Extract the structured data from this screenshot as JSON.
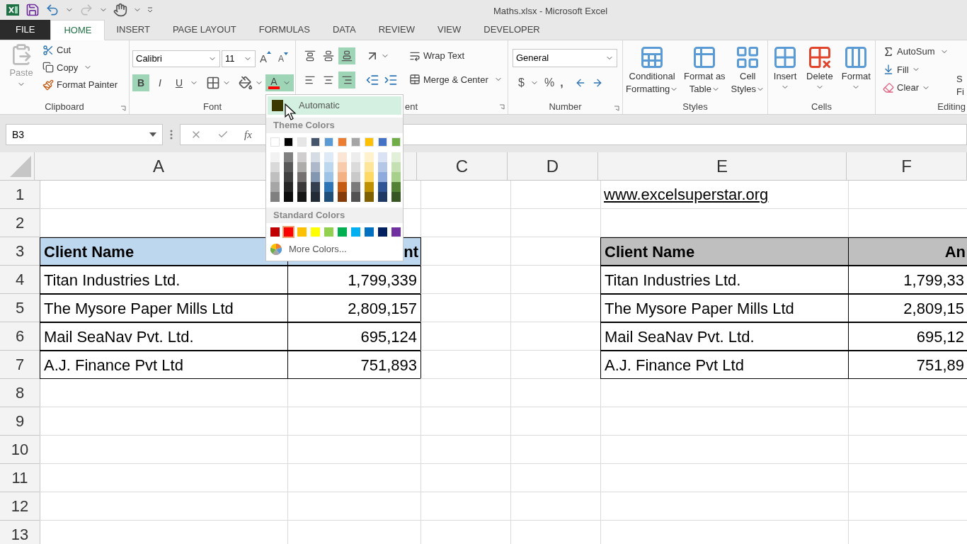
{
  "window": {
    "title": "Maths.xlsx - Microsoft Excel"
  },
  "tabs": [
    {
      "label": "FILE",
      "kind": "file",
      "selected": false
    },
    {
      "label": "HOME",
      "kind": "tab",
      "selected": true
    },
    {
      "label": "INSERT",
      "kind": "tab",
      "selected": false
    },
    {
      "label": "PAGE LAYOUT",
      "kind": "tab",
      "selected": false
    },
    {
      "label": "FORMULAS",
      "kind": "tab",
      "selected": false
    },
    {
      "label": "DATA",
      "kind": "tab",
      "selected": false
    },
    {
      "label": "REVIEW",
      "kind": "tab",
      "selected": false
    },
    {
      "label": "VIEW",
      "kind": "tab",
      "selected": false
    },
    {
      "label": "DEVELOPER",
      "kind": "tab",
      "selected": false
    }
  ],
  "ribbon": {
    "clipboard": {
      "label": "Clipboard",
      "paste": "Paste",
      "cut": "Cut",
      "copy": "Copy",
      "format_painter": "Format Painter"
    },
    "font": {
      "label": "Font",
      "font_name": "Calibri",
      "font_size": "11",
      "grow": "A",
      "shrink": "A",
      "bold": {
        "label": "B",
        "selected": true
      },
      "italic": {
        "label": "I",
        "selected": false
      },
      "underline": {
        "label": "U",
        "selected": false
      },
      "font_color": {
        "label": "A",
        "color": "#ff0000",
        "expanded": true
      }
    },
    "alignment": {
      "label": "ent",
      "vertical": [
        {
          "selected": false
        },
        {
          "selected": false
        },
        {
          "selected": true
        }
      ],
      "horizontal": [
        {
          "selected": false
        },
        {
          "selected": false
        },
        {
          "selected": true
        }
      ],
      "wrap_text": "Wrap Text",
      "merge": "Merge & Center"
    },
    "number": {
      "label": "Number",
      "format": "General",
      "currency": "$",
      "percent": "%",
      "comma": ","
    },
    "styles": {
      "label": "Styles",
      "buttons": [
        {
          "lines": [
            "Conditional",
            "Formatting"
          ]
        },
        {
          "lines": [
            "Format as",
            "Table"
          ]
        },
        {
          "lines": [
            "Cell",
            "Styles"
          ]
        }
      ]
    },
    "cells": {
      "label": "Cells",
      "buttons": [
        "Insert",
        "Delete",
        "Format"
      ]
    },
    "editing": {
      "label": "Editing",
      "autosum": "AutoSum",
      "fill": "Fill",
      "clear": "Clear",
      "cut_top": "S",
      "cut_bottom": "Fi"
    }
  },
  "color_picker": {
    "automatic": {
      "label": "Automatic",
      "color": "#3b3800"
    },
    "theme_label": "Theme Colors",
    "theme": [
      {
        "color": "#ffffff",
        "shades": [
          {
            "color": "#f2f2f2"
          },
          {
            "color": "#d9d9d9"
          },
          {
            "color": "#bfbfbf"
          },
          {
            "color": "#a6a6a6"
          },
          {
            "color": "#808080"
          }
        ]
      },
      {
        "color": "#000000",
        "shades": [
          {
            "color": "#808080"
          },
          {
            "color": "#595959"
          },
          {
            "color": "#404040"
          },
          {
            "color": "#262626"
          },
          {
            "color": "#0d0d0d"
          }
        ]
      },
      {
        "color": "#e7e6e6",
        "shades": [
          {
            "color": "#d0cece"
          },
          {
            "color": "#aeabab"
          },
          {
            "color": "#757171"
          },
          {
            "color": "#3a3838"
          },
          {
            "color": "#171616"
          }
        ]
      },
      {
        "color": "#44546a",
        "shades": [
          {
            "color": "#d6dce4"
          },
          {
            "color": "#adb9ca"
          },
          {
            "color": "#8497b0"
          },
          {
            "color": "#333f4f"
          },
          {
            "color": "#222a35"
          }
        ]
      },
      {
        "color": "#5b9bd5",
        "shades": [
          {
            "color": "#deebf6"
          },
          {
            "color": "#bdd7ee"
          },
          {
            "color": "#9dc3e6"
          },
          {
            "color": "#2e75b5"
          },
          {
            "color": "#1f4e79"
          }
        ]
      },
      {
        "color": "#ed7d31",
        "shades": [
          {
            "color": "#fbe5d5"
          },
          {
            "color": "#f7cbac"
          },
          {
            "color": "#f4b183"
          },
          {
            "color": "#c55a11"
          },
          {
            "color": "#843c0b"
          }
        ]
      },
      {
        "color": "#a5a5a5",
        "shades": [
          {
            "color": "#ededed"
          },
          {
            "color": "#dbdbdb"
          },
          {
            "color": "#c9c9c9"
          },
          {
            "color": "#7b7b7b"
          },
          {
            "color": "#525252"
          }
        ]
      },
      {
        "color": "#ffc000",
        "shades": [
          {
            "color": "#fff2cc"
          },
          {
            "color": "#fee599"
          },
          {
            "color": "#ffd965"
          },
          {
            "color": "#bf9000"
          },
          {
            "color": "#7f6000"
          }
        ]
      },
      {
        "color": "#4472c4",
        "shades": [
          {
            "color": "#dae3f3"
          },
          {
            "color": "#b4c7e7"
          },
          {
            "color": "#8faadc"
          },
          {
            "color": "#2f5597"
          },
          {
            "color": "#203864"
          }
        ]
      },
      {
        "color": "#70ad47",
        "shades": [
          {
            "color": "#e2efd9"
          },
          {
            "color": "#c5e0b3"
          },
          {
            "color": "#a8d08d"
          },
          {
            "color": "#538135"
          },
          {
            "color": "#375623"
          }
        ]
      }
    ],
    "standard_label": "Standard Colors",
    "standard": [
      {
        "color": "#c00000",
        "selected": false
      },
      {
        "color": "#ff0000",
        "selected": true
      },
      {
        "color": "#ffc000",
        "selected": false
      },
      {
        "color": "#ffff00",
        "selected": false
      },
      {
        "color": "#92d050",
        "selected": false
      },
      {
        "color": "#00b050",
        "selected": false
      },
      {
        "color": "#00b0f0",
        "selected": false
      },
      {
        "color": "#0070c0",
        "selected": false
      },
      {
        "color": "#002060",
        "selected": false
      },
      {
        "color": "#7030a0",
        "selected": false
      }
    ],
    "more": "More Colors..."
  },
  "formula_bar": {
    "name_box": "B3",
    "function_label": "fx"
  },
  "sheet": {
    "columns": [
      {
        "kind": "shown",
        "label": "A"
      },
      {
        "kind": "covered"
      },
      {
        "kind": "shown",
        "label": "C"
      },
      {
        "kind": "shown",
        "label": "D"
      },
      {
        "kind": "shown",
        "label": "E"
      },
      {
        "kind": "shown",
        "label": "F"
      }
    ],
    "rows": [
      {
        "number": "1",
        "cells": [
          {
            "kind": "blank"
          },
          {
            "kind": "blank"
          },
          {
            "kind": "blank"
          },
          {
            "kind": "blank"
          },
          {
            "kind": "link",
            "text": "www.excelsuperstar.org"
          },
          {
            "kind": "blank"
          }
        ]
      },
      {
        "number": "2"
      },
      {
        "number": "3",
        "cells": [
          {
            "kind": "header",
            "text": "Client Name",
            "color": "#bdd7ee"
          },
          {
            "kind": "header-number",
            "text": "nt",
            "color": "#bdd7ee"
          },
          {
            "kind": "blank"
          },
          {
            "kind": "blank"
          },
          {
            "kind": "header",
            "text": "Client Name",
            "color": "#bfbfbf"
          },
          {
            "kind": "header-number",
            "text": "An",
            "color": "#bfbfbf"
          }
        ]
      },
      {
        "number": "4",
        "cells": [
          {
            "kind": "text",
            "text": "Titan Industries Ltd."
          },
          {
            "kind": "number",
            "text": "1,799,339"
          },
          {
            "kind": "blank"
          },
          {
            "kind": "blank"
          },
          {
            "kind": "text",
            "text": "Titan Industries Ltd."
          },
          {
            "kind": "number",
            "text": "1,799,33"
          }
        ]
      },
      {
        "number": "5",
        "cells": [
          {
            "kind": "text",
            "text": "The Mysore Paper Mills Ltd"
          },
          {
            "kind": "number",
            "text": "2,809,157"
          },
          {
            "kind": "blank"
          },
          {
            "kind": "blank"
          },
          {
            "kind": "text",
            "text": "The Mysore Paper Mills Ltd"
          },
          {
            "kind": "number",
            "text": "2,809,15"
          }
        ]
      },
      {
        "number": "6",
        "cells": [
          {
            "kind": "text",
            "text": "Mail SeaNav Pvt. Ltd."
          },
          {
            "kind": "number",
            "text": "695,124"
          },
          {
            "kind": "blank"
          },
          {
            "kind": "blank"
          },
          {
            "kind": "text",
            "text": "Mail SeaNav Pvt. Ltd."
          },
          {
            "kind": "number",
            "text": "695,12"
          }
        ]
      },
      {
        "number": "7",
        "cells": [
          {
            "kind": "text",
            "text": "A.J. Finance Pvt Ltd"
          },
          {
            "kind": "number",
            "text": "751,893"
          },
          {
            "kind": "blank"
          },
          {
            "kind": "blank"
          },
          {
            "kind": "text",
            "text": "A.J. Finance Pvt Ltd"
          },
          {
            "kind": "number",
            "text": "751,89"
          }
        ]
      },
      {
        "number": "8"
      },
      {
        "number": "9"
      },
      {
        "number": "10"
      },
      {
        "number": "11"
      },
      {
        "number": "12"
      },
      {
        "number": "13"
      }
    ]
  }
}
